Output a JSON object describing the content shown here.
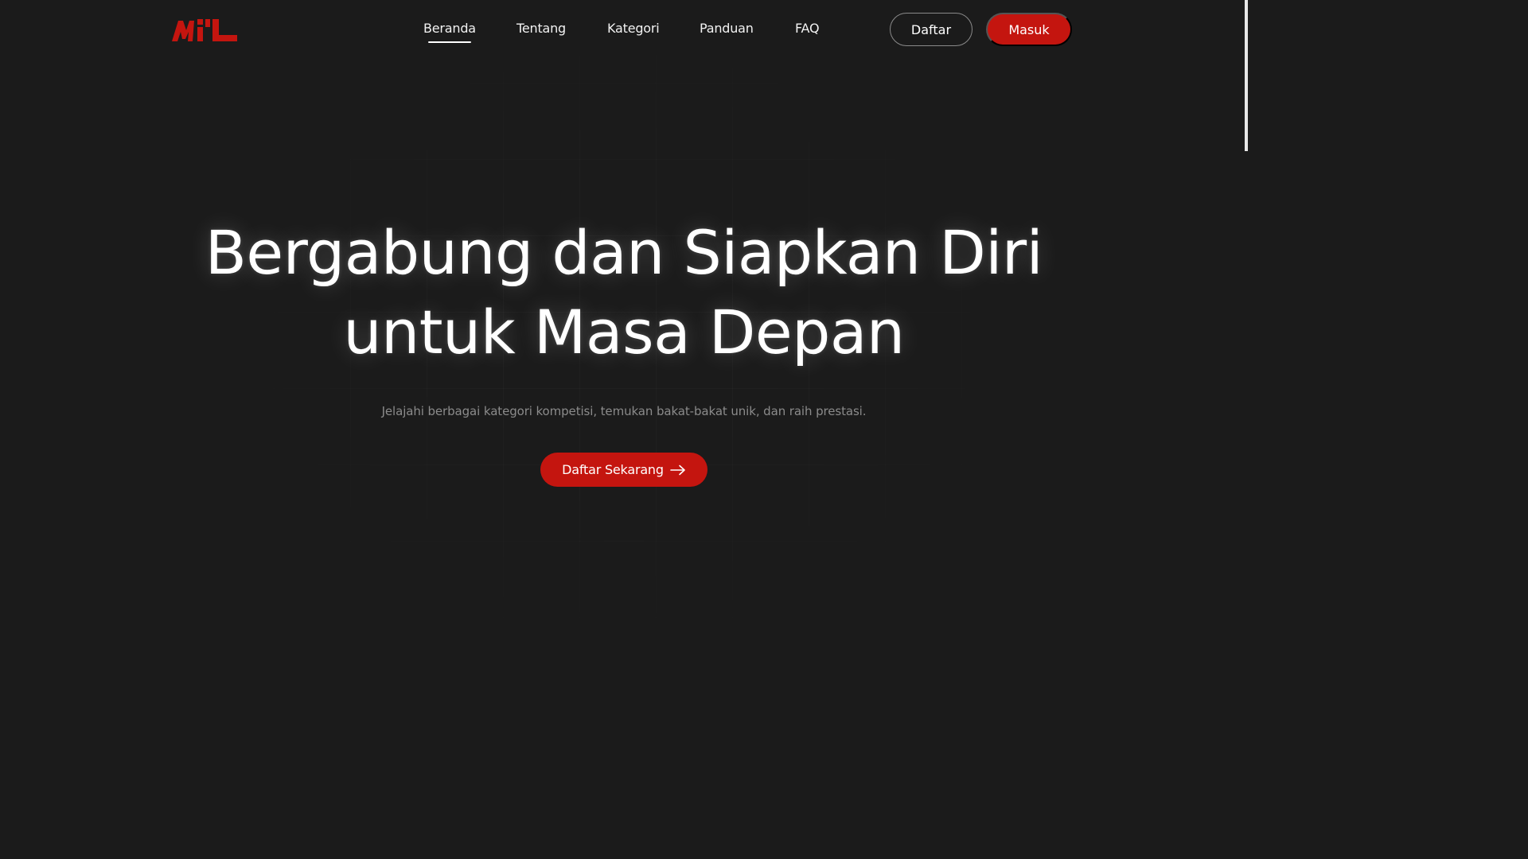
{
  "brand": {
    "logo_text": "MIL",
    "logo_color": "#c4150f"
  },
  "nav": {
    "links": [
      {
        "label": "Beranda",
        "active": true
      },
      {
        "label": "Tentang",
        "active": false
      },
      {
        "label": "Kategori",
        "active": false
      },
      {
        "label": "Panduan",
        "active": false
      },
      {
        "label": "FAQ",
        "active": false
      }
    ],
    "register_label": "Daftar",
    "login_label": "Masuk"
  },
  "hero": {
    "title_line1": "Bergabung dan Siapkan Diri",
    "title_line2": "untuk Masa Depan",
    "subtitle": "Jelajahi berbagai kategori kompetisi, temukan bakat-bakat unik, dan raih prestasi.",
    "cta_label": "Daftar Sekarang",
    "cta_icon": "arrow-right-icon"
  },
  "colors": {
    "background": "#1b1b1b",
    "accent": "#c4150f",
    "text": "#ffffff",
    "muted_text": "#8b8b8b"
  }
}
